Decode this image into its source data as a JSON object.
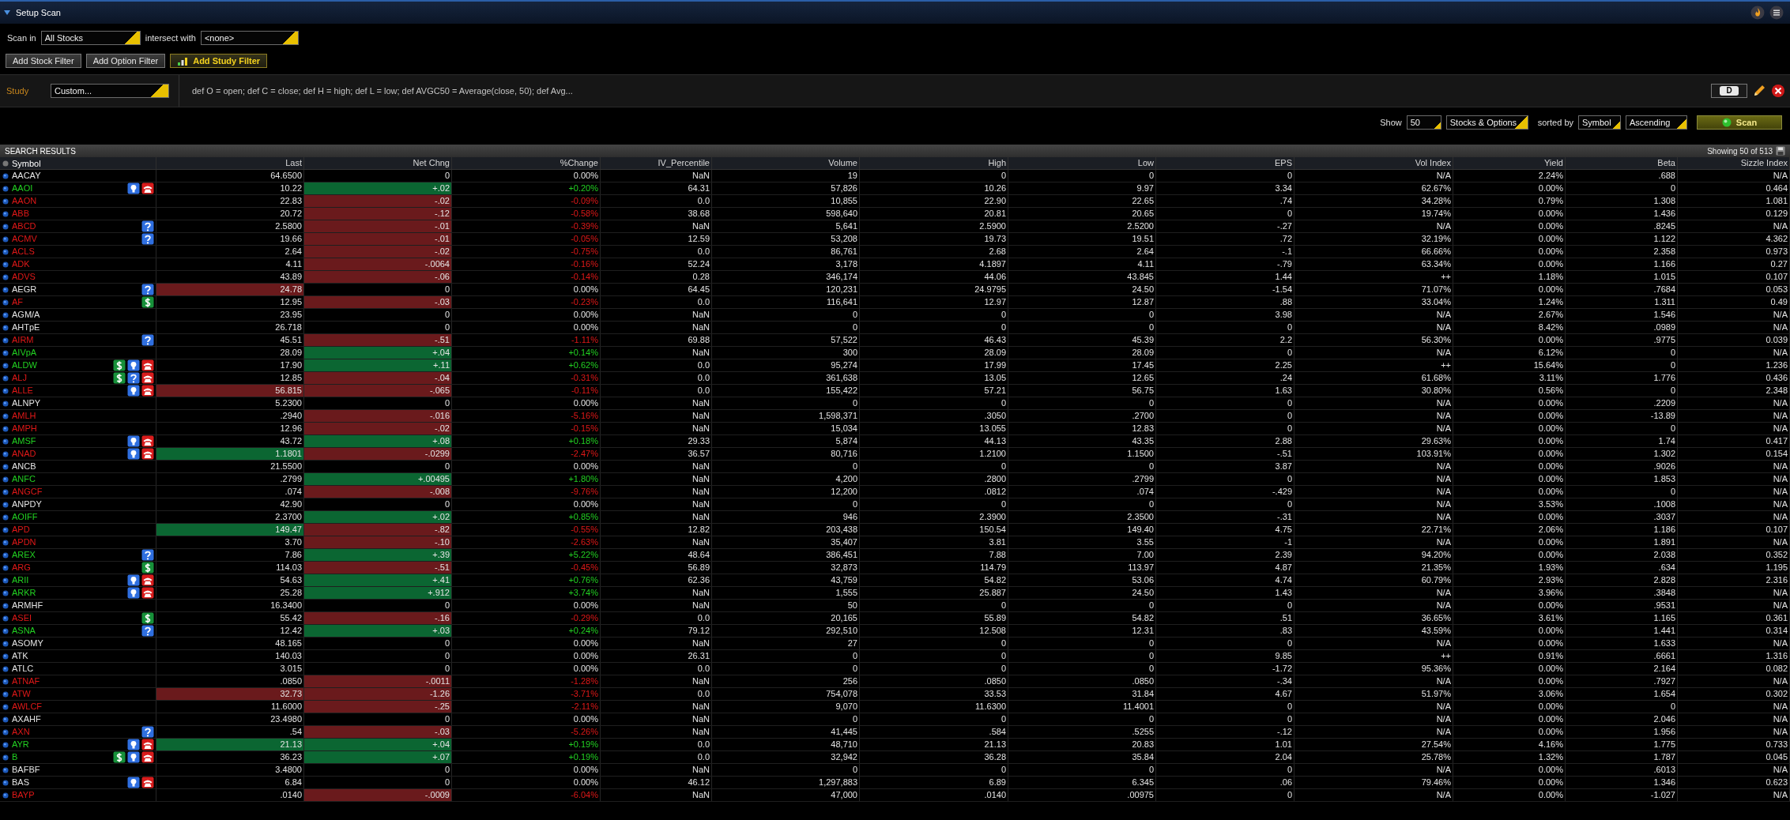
{
  "title": "Setup Scan",
  "scan_in": {
    "label": "Scan in",
    "value": "All Stocks"
  },
  "intersect": {
    "label": "intersect with",
    "value": "<none>"
  },
  "filter_buttons": [
    {
      "label": "Add Stock Filter",
      "kind": "plain"
    },
    {
      "label": "Add Option Filter",
      "kind": "plain"
    },
    {
      "label": "Add Study Filter",
      "kind": "study"
    }
  ],
  "study": {
    "label": "Study",
    "value": "Custom...",
    "formula": "def O = open;  def C = close; def H = high; def L = low; def AVGC50 = Average(close, 50); def Avg...",
    "period": "D"
  },
  "options": {
    "show_label": "Show",
    "show_value": "50",
    "type_value": "Stocks & Options",
    "sorted_label": "sorted by",
    "sort_field": "Symbol",
    "sort_order": "Ascending",
    "scan_button": "Scan"
  },
  "results": {
    "title": "SEARCH RESULTS",
    "showing": "Showing 50 of 513",
    "columns": [
      "Symbol",
      "Last",
      "Net Chng",
      "%Change",
      "IV_Percentile",
      "Volume",
      "High",
      "Low",
      "EPS",
      "Vol Index",
      "Yield",
      "Beta",
      "Sizzle Index"
    ],
    "rows": [
      {
        "kind": "flat",
        "flags": [],
        "cells": [
          "AACAY",
          "64.6500",
          "0",
          "0.00%",
          "NaN",
          "19",
          "0",
          "0",
          "0",
          "N/A",
          "2.24%",
          ".688",
          "N/A"
        ]
      },
      {
        "kind": "up",
        "flags": [
          {
            "kind": "idea"
          },
          {
            "kind": "phone"
          }
        ],
        "cells": [
          "AAOI",
          "10.22",
          "+.02",
          "+0.20%",
          "64.31",
          "57,826",
          "10.26",
          "9.97",
          "3.34",
          "62.67%",
          "0.00%",
          "0",
          "0.464"
        ]
      },
      {
        "kind": "down",
        "flags": [],
        "cells": [
          "AAON",
          "22.83",
          "-.02",
          "-0.09%",
          "0.0",
          "10,855",
          "22.90",
          "22.65",
          ".74",
          "34.28%",
          "0.79%",
          "1.308",
          "1.081"
        ]
      },
      {
        "kind": "down",
        "flags": [],
        "cells": [
          "ABB",
          "20.72",
          "-.12",
          "-0.58%",
          "38.68",
          "598,640",
          "20.81",
          "20.65",
          "0",
          "19.74%",
          "0.00%",
          "1.436",
          "0.129"
        ]
      },
      {
        "kind": "down",
        "flags": [
          {
            "kind": "question"
          }
        ],
        "cells": [
          "ABCD",
          "2.5800",
          "-.01",
          "-0.39%",
          "NaN",
          "5,641",
          "2.5900",
          "2.5200",
          "-.27",
          "N/A",
          "0.00%",
          ".8245",
          "N/A"
        ]
      },
      {
        "kind": "down",
        "flags": [
          {
            "kind": "question"
          }
        ],
        "cells": [
          "ACMV",
          "19.66",
          "-.01",
          "-0.05%",
          "12.59",
          "53,208",
          "19.73",
          "19.51",
          ".72",
          "32.19%",
          "0.00%",
          "1.122",
          "4.362"
        ]
      },
      {
        "kind": "down",
        "flags": [],
        "cells": [
          "ACLS",
          "2.64",
          "-.02",
          "-0.75%",
          "0.0",
          "86,761",
          "2.68",
          "2.64",
          "-.1",
          "66.66%",
          "0.00%",
          "2.358",
          "0.973"
        ]
      },
      {
        "kind": "down",
        "flags": [],
        "cells": [
          "ADK",
          "4.11",
          "-.0064",
          "-0.16%",
          "52.24",
          "3,178",
          "4.1897",
          "4.11",
          "-.79",
          "63.34%",
          "0.00%",
          "1.166",
          "0.27"
        ]
      },
      {
        "kind": "down",
        "flags": [],
        "cells": [
          "ADVS",
          "43.89",
          "-.06",
          "-0.14%",
          "0.28",
          "346,174",
          "44.06",
          "43.845",
          "1.44",
          "++",
          "1.18%",
          "1.015",
          "0.107"
        ]
      },
      {
        "kind": "flat",
        "flags": [
          {
            "kind": "question"
          }
        ],
        "flash": {
          "kind": "down"
        },
        "cells": [
          "AEGR",
          "24.78",
          "0",
          "0.00%",
          "64.45",
          "120,231",
          "24.9795",
          "24.50",
          "-1.54",
          "71.07%",
          "0.00%",
          ".7684",
          "0.053"
        ]
      },
      {
        "kind": "down",
        "flags": [
          {
            "kind": "dollar"
          }
        ],
        "cells": [
          "AF",
          "12.95",
          "-.03",
          "-0.23%",
          "0.0",
          "116,641",
          "12.97",
          "12.87",
          ".88",
          "33.04%",
          "1.24%",
          "1.311",
          "0.49"
        ]
      },
      {
        "kind": "flat",
        "flags": [],
        "cells": [
          "AGM/A",
          "23.95",
          "0",
          "0.00%",
          "NaN",
          "0",
          "0",
          "0",
          "3.98",
          "N/A",
          "2.67%",
          "1.546",
          "N/A"
        ]
      },
      {
        "kind": "flat",
        "flags": [],
        "cells": [
          "AHTpE",
          "26.718",
          "0",
          "0.00%",
          "NaN",
          "0",
          "0",
          "0",
          "0",
          "N/A",
          "8.42%",
          ".0989",
          "N/A"
        ]
      },
      {
        "kind": "down",
        "flags": [
          {
            "kind": "question"
          }
        ],
        "cells": [
          "AIRM",
          "45.51",
          "-.51",
          "-1.11%",
          "69.88",
          "57,522",
          "46.43",
          "45.39",
          "2.2",
          "56.30%",
          "0.00%",
          ".9775",
          "0.039"
        ]
      },
      {
        "kind": "up",
        "flags": [],
        "cells": [
          "AIVpA",
          "28.09",
          "+.04",
          "+0.14%",
          "NaN",
          "300",
          "28.09",
          "28.09",
          "0",
          "N/A",
          "6.12%",
          "0",
          "N/A"
        ]
      },
      {
        "kind": "up",
        "flags": [
          {
            "kind": "dollar"
          },
          {
            "kind": "idea"
          },
          {
            "kind": "phone"
          }
        ],
        "cells": [
          "ALDW",
          "17.90",
          "+.11",
          "+0.62%",
          "0.0",
          "95,274",
          "17.99",
          "17.45",
          "2.25",
          "++",
          "15.64%",
          "0",
          "1.236"
        ]
      },
      {
        "kind": "down",
        "flags": [
          {
            "kind": "dollar"
          },
          {
            "kind": "question"
          },
          {
            "kind": "phone"
          }
        ],
        "cells": [
          "ALJ",
          "12.85",
          "-.04",
          "-0.31%",
          "0.0",
          "361,638",
          "13.05",
          "12.65",
          ".24",
          "61.68%",
          "3.11%",
          "1.776",
          "0.436"
        ]
      },
      {
        "kind": "down",
        "flags": [
          {
            "kind": "idea"
          },
          {
            "kind": "phone"
          }
        ],
        "flash": {
          "kind": "down"
        },
        "cells": [
          "ALLE",
          "56.815",
          "-.065",
          "-0.11%",
          "0.0",
          "155,422",
          "57.21",
          "56.75",
          "1.63",
          "30.80%",
          "0.56%",
          "0",
          "2.348"
        ]
      },
      {
        "kind": "flat",
        "flags": [],
        "cells": [
          "ALNPY",
          "5.2300",
          "0",
          "0.00%",
          "NaN",
          "0",
          "0",
          "0",
          "0",
          "N/A",
          "0.00%",
          ".2209",
          "N/A"
        ]
      },
      {
        "kind": "down",
        "flags": [],
        "cells": [
          "AMLH",
          ".2940",
          "-.016",
          "-5.16%",
          "NaN",
          "1,598,371",
          ".3050",
          ".2700",
          "0",
          "N/A",
          "0.00%",
          "-13.89",
          "N/A"
        ]
      },
      {
        "kind": "down",
        "flags": [],
        "cells": [
          "AMPH",
          "12.96",
          "-.02",
          "-0.15%",
          "NaN",
          "15,034",
          "13.055",
          "12.83",
          "0",
          "N/A",
          "0.00%",
          "0",
          "N/A"
        ]
      },
      {
        "kind": "up",
        "flags": [
          {
            "kind": "idea"
          },
          {
            "kind": "phone"
          }
        ],
        "cells": [
          "AMSF",
          "43.72",
          "+.08",
          "+0.18%",
          "29.33",
          "5,874",
          "44.13",
          "43.35",
          "2.88",
          "29.63%",
          "0.00%",
          "1.74",
          "0.417"
        ]
      },
      {
        "kind": "down",
        "flags": [
          {
            "kind": "idea"
          },
          {
            "kind": "phone"
          }
        ],
        "flash": {
          "kind": "up"
        },
        "cells": [
          "ANAD",
          "1.1801",
          "-.0299",
          "-2.47%",
          "36.57",
          "80,716",
          "1.2100",
          "1.1500",
          "-.51",
          "103.91%",
          "0.00%",
          "1.302",
          "0.154"
        ]
      },
      {
        "kind": "flat",
        "flags": [],
        "cells": [
          "ANCB",
          "21.5500",
          "0",
          "0.00%",
          "NaN",
          "0",
          "0",
          "0",
          "3.87",
          "N/A",
          "0.00%",
          ".9026",
          "N/A"
        ]
      },
      {
        "kind": "up",
        "flags": [],
        "cells": [
          "ANFC",
          ".2799",
          "+.00495",
          "+1.80%",
          "NaN",
          "4,200",
          ".2800",
          ".2799",
          "0",
          "N/A",
          "0.00%",
          "1.853",
          "N/A"
        ]
      },
      {
        "kind": "down",
        "flags": [],
        "cells": [
          "ANGCF",
          ".074",
          "-.008",
          "-9.76%",
          "NaN",
          "12,200",
          ".0812",
          ".074",
          "-.429",
          "N/A",
          "0.00%",
          "0",
          "N/A"
        ]
      },
      {
        "kind": "flat",
        "flags": [],
        "cells": [
          "ANPDY",
          "42.90",
          "0",
          "0.00%",
          "NaN",
          "0",
          "0",
          "0",
          "0",
          "N/A",
          "3.53%",
          ".1008",
          "N/A"
        ]
      },
      {
        "kind": "up",
        "flags": [],
        "cells": [
          "AOIFF",
          "2.3700",
          "+.02",
          "+0.85%",
          "NaN",
          "946",
          "2.3900",
          "2.3500",
          "-.31",
          "N/A",
          "0.00%",
          ".3037",
          "N/A"
        ]
      },
      {
        "kind": "down",
        "flags": [],
        "flash": {
          "kind": "up"
        },
        "cells": [
          "APD",
          "149.47",
          "-.82",
          "-0.55%",
          "12.82",
          "203,438",
          "150.54",
          "149.40",
          "4.75",
          "22.71%",
          "2.06%",
          "1.186",
          "0.107"
        ]
      },
      {
        "kind": "down",
        "flags": [],
        "cells": [
          "APDN",
          "3.70",
          "-.10",
          "-2.63%",
          "NaN",
          "35,407",
          "3.81",
          "3.55",
          "-1",
          "N/A",
          "0.00%",
          "1.891",
          "N/A"
        ]
      },
      {
        "kind": "up",
        "flags": [
          {
            "kind": "question"
          }
        ],
        "cells": [
          "AREX",
          "7.86",
          "+.39",
          "+5.22%",
          "48.64",
          "386,451",
          "7.88",
          "7.00",
          "2.39",
          "94.20%",
          "0.00%",
          "2.038",
          "0.352"
        ]
      },
      {
        "kind": "down",
        "flags": [
          {
            "kind": "dollar"
          }
        ],
        "cells": [
          "ARG",
          "114.03",
          "-.51",
          "-0.45%",
          "56.89",
          "32,873",
          "114.79",
          "113.97",
          "4.87",
          "21.35%",
          "1.93%",
          ".634",
          "1.195"
        ]
      },
      {
        "kind": "up",
        "flags": [
          {
            "kind": "idea"
          },
          {
            "kind": "phone"
          }
        ],
        "cells": [
          "ARII",
          "54.63",
          "+.41",
          "+0.76%",
          "62.36",
          "43,759",
          "54.82",
          "53.06",
          "4.74",
          "60.79%",
          "2.93%",
          "2.828",
          "2.316"
        ]
      },
      {
        "kind": "up",
        "flags": [
          {
            "kind": "idea"
          },
          {
            "kind": "phone"
          }
        ],
        "cells": [
          "ARKR",
          "25.28",
          "+.912",
          "+3.74%",
          "NaN",
          "1,555",
          "25.887",
          "24.50",
          "1.43",
          "N/A",
          "3.96%",
          ".3848",
          "N/A"
        ]
      },
      {
        "kind": "flat",
        "flags": [],
        "cells": [
          "ARMHF",
          "16.3400",
          "0",
          "0.00%",
          "NaN",
          "50",
          "0",
          "0",
          "0",
          "N/A",
          "0.00%",
          ".9531",
          "N/A"
        ]
      },
      {
        "kind": "down",
        "flags": [
          {
            "kind": "dollar"
          }
        ],
        "cells": [
          "ASEI",
          "55.42",
          "-.16",
          "-0.29%",
          "0.0",
          "20,165",
          "55.89",
          "54.82",
          ".51",
          "36.65%",
          "3.61%",
          "1.165",
          "0.361"
        ]
      },
      {
        "kind": "up",
        "flags": [
          {
            "kind": "question"
          }
        ],
        "cells": [
          "ASNA",
          "12.42",
          "+.03",
          "+0.24%",
          "79.12",
          "292,510",
          "12.508",
          "12.31",
          ".83",
          "43.59%",
          "0.00%",
          "1.441",
          "0.314"
        ]
      },
      {
        "kind": "flat",
        "flags": [],
        "cells": [
          "ASOMY",
          "48.165",
          "0",
          "0.00%",
          "NaN",
          "27",
          "0",
          "0",
          "0",
          "N/A",
          "0.00%",
          "1.633",
          "N/A"
        ]
      },
      {
        "kind": "flat",
        "flags": [],
        "cells": [
          "ATK",
          "140.03",
          "0",
          "0.00%",
          "26.31",
          "0",
          "0",
          "0",
          "9.85",
          "++",
          "0.91%",
          ".6661",
          "1.316"
        ]
      },
      {
        "kind": "flat",
        "flags": [],
        "cells": [
          "ATLC",
          "3.015",
          "0",
          "0.00%",
          "0.0",
          "0",
          "0",
          "0",
          "-1.72",
          "95.36%",
          "0.00%",
          "2.164",
          "0.082"
        ]
      },
      {
        "kind": "down",
        "flags": [],
        "cells": [
          "ATNAF",
          ".0850",
          "-.0011",
          "-1.28%",
          "NaN",
          "256",
          ".0850",
          ".0850",
          "-.34",
          "N/A",
          "0.00%",
          ".7927",
          "N/A"
        ]
      },
      {
        "kind": "down",
        "flags": [],
        "flash": {
          "kind": "down"
        },
        "cells": [
          "ATW",
          "32.73",
          "-1.26",
          "-3.71%",
          "0.0",
          "754,078",
          "33.53",
          "31.84",
          "4.67",
          "51.97%",
          "3.06%",
          "1.654",
          "0.302"
        ]
      },
      {
        "kind": "down",
        "flags": [],
        "cells": [
          "AWLCF",
          "11.6000",
          "-.25",
          "-2.11%",
          "NaN",
          "9,070",
          "11.6300",
          "11.4001",
          "0",
          "N/A",
          "0.00%",
          "0",
          "N/A"
        ]
      },
      {
        "kind": "flat",
        "flags": [],
        "cells": [
          "AXAHF",
          "23.4980",
          "0",
          "0.00%",
          "NaN",
          "0",
          "0",
          "0",
          "0",
          "N/A",
          "0.00%",
          "2.046",
          "N/A"
        ]
      },
      {
        "kind": "down",
        "flags": [
          {
            "kind": "question"
          }
        ],
        "cells": [
          "AXN",
          ".54",
          "-.03",
          "-5.26%",
          "NaN",
          "41,445",
          ".584",
          ".5255",
          "-.12",
          "N/A",
          "0.00%",
          "1.956",
          "N/A"
        ]
      },
      {
        "kind": "up",
        "flags": [
          {
            "kind": "idea"
          },
          {
            "kind": "phone"
          }
        ],
        "flash": {
          "kind": "up"
        },
        "cells": [
          "AYR",
          "21.13",
          "+.04",
          "+0.19%",
          "0.0",
          "48,710",
          "21.13",
          "20.83",
          "1.01",
          "27.54%",
          "4.16%",
          "1.775",
          "0.733"
        ]
      },
      {
        "kind": "up",
        "flags": [
          {
            "kind": "dollar"
          },
          {
            "kind": "idea"
          },
          {
            "kind": "phone"
          }
        ],
        "cells": [
          "B",
          "36.23",
          "+.07",
          "+0.19%",
          "0.0",
          "32,942",
          "36.28",
          "35.84",
          "2.04",
          "25.78%",
          "1.32%",
          "1.787",
          "0.045"
        ]
      },
      {
        "kind": "flat",
        "flags": [],
        "cells": [
          "BAFBF",
          "3.4800",
          "0",
          "0.00%",
          "NaN",
          "0",
          "0",
          "0",
          "0",
          "N/A",
          "0.00%",
          ".6013",
          "N/A"
        ]
      },
      {
        "kind": "flat",
        "flags": [
          {
            "kind": "idea"
          },
          {
            "kind": "phone"
          }
        ],
        "cells": [
          "BAS",
          "6.84",
          "0",
          "0.00%",
          "46.12",
          "1,297,883",
          "6.89",
          "6.345",
          ".06",
          "79.46%",
          "0.00%",
          "1.346",
          "0.623"
        ]
      },
      {
        "kind": "down",
        "flags": [],
        "cells": [
          "BAYP",
          ".0140",
          "-.0009",
          "-6.04%",
          "NaN",
          "47,000",
          ".0140",
          ".00975",
          "0",
          "N/A",
          "0.00%",
          "-1.027",
          "N/A"
        ]
      }
    ]
  }
}
